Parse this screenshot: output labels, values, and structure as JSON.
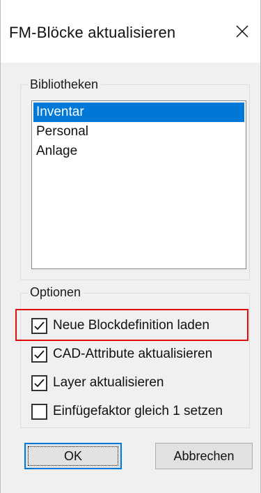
{
  "dialog": {
    "title": "FM-Blöcke aktualisieren",
    "close_icon": "close-icon"
  },
  "libraries": {
    "legend": "Bibliotheken",
    "items": [
      {
        "label": "Inventar",
        "selected": true
      },
      {
        "label": "Personal",
        "selected": false
      },
      {
        "label": "Anlage",
        "selected": false
      }
    ]
  },
  "options": {
    "legend": "Optionen",
    "items": [
      {
        "label": "Neue Blockdefinition laden",
        "checked": true,
        "highlighted": true
      },
      {
        "label": "CAD-Attribute aktualisieren",
        "checked": true,
        "highlighted": false
      },
      {
        "label": "Layer aktualisieren",
        "checked": true,
        "highlighted": false
      },
      {
        "label": "Einfügefaktor gleich 1 setzen",
        "checked": false,
        "highlighted": false
      }
    ]
  },
  "buttons": {
    "ok_label": "OK",
    "cancel_label": "Abbrechen"
  },
  "colors": {
    "accent": "#0078d7",
    "highlight": "#e00d0d",
    "dialog_background": "#f0f0f0"
  }
}
